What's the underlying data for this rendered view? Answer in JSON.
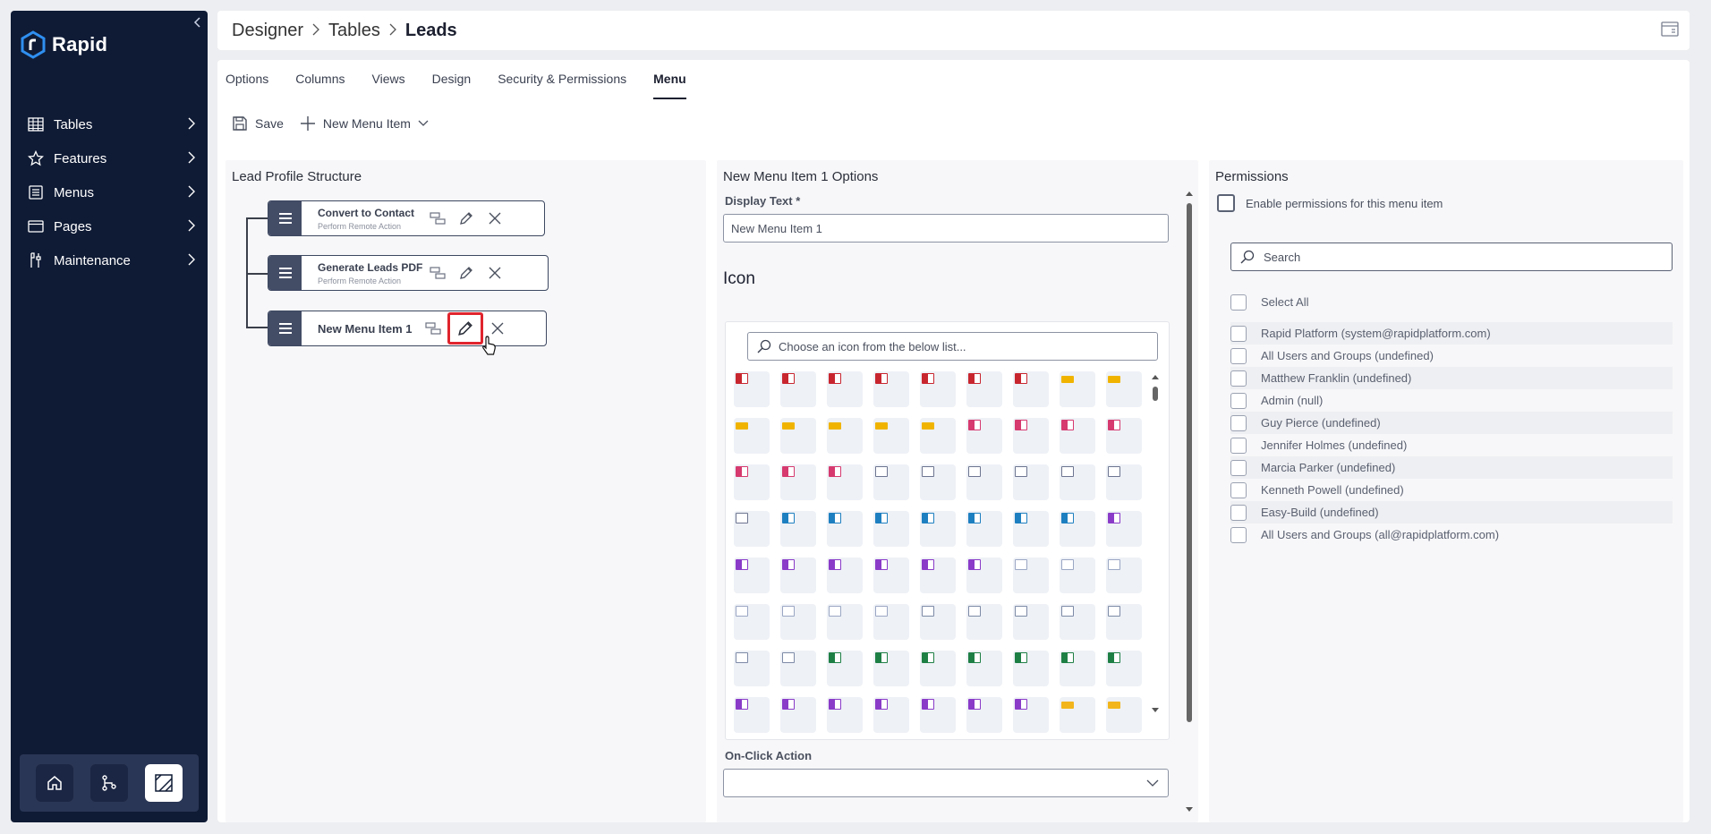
{
  "app": {
    "name": "Rapid"
  },
  "sidebar": {
    "items": [
      {
        "label": "Tables",
        "icon": "table-icon"
      },
      {
        "label": "Features",
        "icon": "star-icon"
      },
      {
        "label": "Menus",
        "icon": "menu-icon"
      },
      {
        "label": "Pages",
        "icon": "page-icon"
      },
      {
        "label": "Maintenance",
        "icon": "tools-icon"
      }
    ],
    "bottom_buttons": [
      "home-icon",
      "sitemap-icon",
      "designer-icon"
    ]
  },
  "breadcrumb": {
    "items": [
      "Designer",
      "Tables",
      "Leads"
    ]
  },
  "tabs": [
    "Options",
    "Columns",
    "Views",
    "Design",
    "Security & Permissions",
    "Menu"
  ],
  "active_tab": "Menu",
  "toolbar": {
    "save_label": "Save",
    "new_item_label": "New Menu Item"
  },
  "structure": {
    "title": "Lead Profile Structure",
    "nodes": [
      {
        "title": "Convert to Contact",
        "subtitle": "Perform Remote Action"
      },
      {
        "title": "Generate Leads PDF",
        "subtitle": "Perform Remote Action"
      },
      {
        "title": "New Menu Item 1",
        "subtitle": ""
      }
    ]
  },
  "options": {
    "title": "New Menu Item 1 Options",
    "display_text_label": "Display Text *",
    "display_text_value": "New Menu Item 1",
    "icon_heading": "Icon",
    "icon_search_placeholder": "Choose an icon from the below list...",
    "onclick_label": "On-Click Action",
    "onclick_value": ""
  },
  "icon_colors": {
    "pdf": "#c8262f",
    "key": "#f0b400",
    "music": "#d63a6f",
    "calendar": "#6d7590",
    "outlook": "#1e7fc0",
    "onenote": "#8a3bc8",
    "doc": "#9aa6c3",
    "text": "#7d8aa6",
    "excel": "#1e7f45",
    "folder": "#f2b51c"
  },
  "permissions": {
    "title": "Permissions",
    "enable_label": "Enable permissions for this menu item",
    "search_placeholder": "Search",
    "select_all_label": "Select All",
    "users": [
      "Rapid Platform (system@rapidplatform.com)",
      "All Users and Groups (undefined)",
      "Matthew Franklin (undefined)",
      "Admin (null)",
      "Guy Pierce (undefined)",
      "Jennifer Holmes (undefined)",
      "Marcia Parker (undefined)",
      "Kenneth Powell (undefined)",
      "Easy-Build (undefined)",
      "All Users and Groups (all@rapidplatform.com)"
    ]
  }
}
